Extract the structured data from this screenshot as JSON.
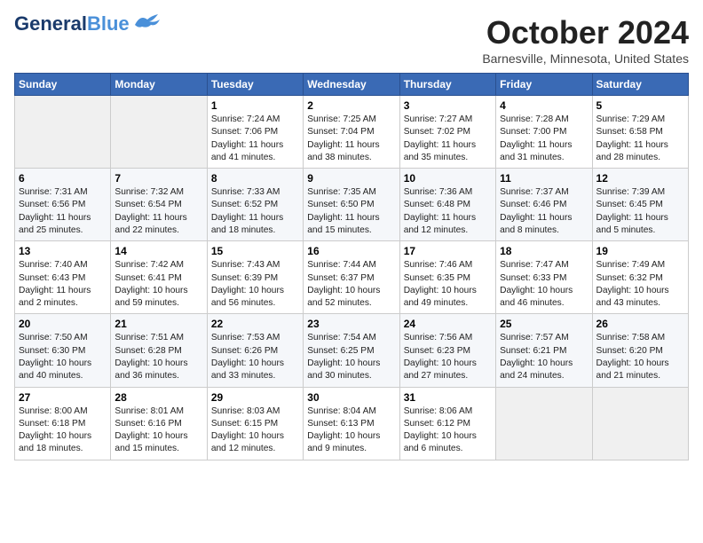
{
  "header": {
    "logo_line1": "General",
    "logo_line2": "Blue",
    "month_title": "October 2024",
    "location": "Barnesville, Minnesota, United States"
  },
  "days_of_week": [
    "Sunday",
    "Monday",
    "Tuesday",
    "Wednesday",
    "Thursday",
    "Friday",
    "Saturday"
  ],
  "weeks": [
    [
      {
        "num": "",
        "empty": true
      },
      {
        "num": "",
        "empty": true
      },
      {
        "num": "1",
        "sunrise": "7:24 AM",
        "sunset": "7:06 PM",
        "daylight": "11 hours and 41 minutes."
      },
      {
        "num": "2",
        "sunrise": "7:25 AM",
        "sunset": "7:04 PM",
        "daylight": "11 hours and 38 minutes."
      },
      {
        "num": "3",
        "sunrise": "7:27 AM",
        "sunset": "7:02 PM",
        "daylight": "11 hours and 35 minutes."
      },
      {
        "num": "4",
        "sunrise": "7:28 AM",
        "sunset": "7:00 PM",
        "daylight": "11 hours and 31 minutes."
      },
      {
        "num": "5",
        "sunrise": "7:29 AM",
        "sunset": "6:58 PM",
        "daylight": "11 hours and 28 minutes."
      }
    ],
    [
      {
        "num": "6",
        "sunrise": "7:31 AM",
        "sunset": "6:56 PM",
        "daylight": "11 hours and 25 minutes."
      },
      {
        "num": "7",
        "sunrise": "7:32 AM",
        "sunset": "6:54 PM",
        "daylight": "11 hours and 22 minutes."
      },
      {
        "num": "8",
        "sunrise": "7:33 AM",
        "sunset": "6:52 PM",
        "daylight": "11 hours and 18 minutes."
      },
      {
        "num": "9",
        "sunrise": "7:35 AM",
        "sunset": "6:50 PM",
        "daylight": "11 hours and 15 minutes."
      },
      {
        "num": "10",
        "sunrise": "7:36 AM",
        "sunset": "6:48 PM",
        "daylight": "11 hours and 12 minutes."
      },
      {
        "num": "11",
        "sunrise": "7:37 AM",
        "sunset": "6:46 PM",
        "daylight": "11 hours and 8 minutes."
      },
      {
        "num": "12",
        "sunrise": "7:39 AM",
        "sunset": "6:45 PM",
        "daylight": "11 hours and 5 minutes."
      }
    ],
    [
      {
        "num": "13",
        "sunrise": "7:40 AM",
        "sunset": "6:43 PM",
        "daylight": "11 hours and 2 minutes."
      },
      {
        "num": "14",
        "sunrise": "7:42 AM",
        "sunset": "6:41 PM",
        "daylight": "10 hours and 59 minutes."
      },
      {
        "num": "15",
        "sunrise": "7:43 AM",
        "sunset": "6:39 PM",
        "daylight": "10 hours and 56 minutes."
      },
      {
        "num": "16",
        "sunrise": "7:44 AM",
        "sunset": "6:37 PM",
        "daylight": "10 hours and 52 minutes."
      },
      {
        "num": "17",
        "sunrise": "7:46 AM",
        "sunset": "6:35 PM",
        "daylight": "10 hours and 49 minutes."
      },
      {
        "num": "18",
        "sunrise": "7:47 AM",
        "sunset": "6:33 PM",
        "daylight": "10 hours and 46 minutes."
      },
      {
        "num": "19",
        "sunrise": "7:49 AM",
        "sunset": "6:32 PM",
        "daylight": "10 hours and 43 minutes."
      }
    ],
    [
      {
        "num": "20",
        "sunrise": "7:50 AM",
        "sunset": "6:30 PM",
        "daylight": "10 hours and 40 minutes."
      },
      {
        "num": "21",
        "sunrise": "7:51 AM",
        "sunset": "6:28 PM",
        "daylight": "10 hours and 36 minutes."
      },
      {
        "num": "22",
        "sunrise": "7:53 AM",
        "sunset": "6:26 PM",
        "daylight": "10 hours and 33 minutes."
      },
      {
        "num": "23",
        "sunrise": "7:54 AM",
        "sunset": "6:25 PM",
        "daylight": "10 hours and 30 minutes."
      },
      {
        "num": "24",
        "sunrise": "7:56 AM",
        "sunset": "6:23 PM",
        "daylight": "10 hours and 27 minutes."
      },
      {
        "num": "25",
        "sunrise": "7:57 AM",
        "sunset": "6:21 PM",
        "daylight": "10 hours and 24 minutes."
      },
      {
        "num": "26",
        "sunrise": "7:58 AM",
        "sunset": "6:20 PM",
        "daylight": "10 hours and 21 minutes."
      }
    ],
    [
      {
        "num": "27",
        "sunrise": "8:00 AM",
        "sunset": "6:18 PM",
        "daylight": "10 hours and 18 minutes."
      },
      {
        "num": "28",
        "sunrise": "8:01 AM",
        "sunset": "6:16 PM",
        "daylight": "10 hours and 15 minutes."
      },
      {
        "num": "29",
        "sunrise": "8:03 AM",
        "sunset": "6:15 PM",
        "daylight": "10 hours and 12 minutes."
      },
      {
        "num": "30",
        "sunrise": "8:04 AM",
        "sunset": "6:13 PM",
        "daylight": "10 hours and 9 minutes."
      },
      {
        "num": "31",
        "sunrise": "8:06 AM",
        "sunset": "6:12 PM",
        "daylight": "10 hours and 6 minutes."
      },
      {
        "num": "",
        "empty": true
      },
      {
        "num": "",
        "empty": true
      }
    ]
  ],
  "labels": {
    "sunrise_prefix": "Sunrise: ",
    "sunset_prefix": "Sunset: ",
    "daylight_prefix": "Daylight: "
  }
}
